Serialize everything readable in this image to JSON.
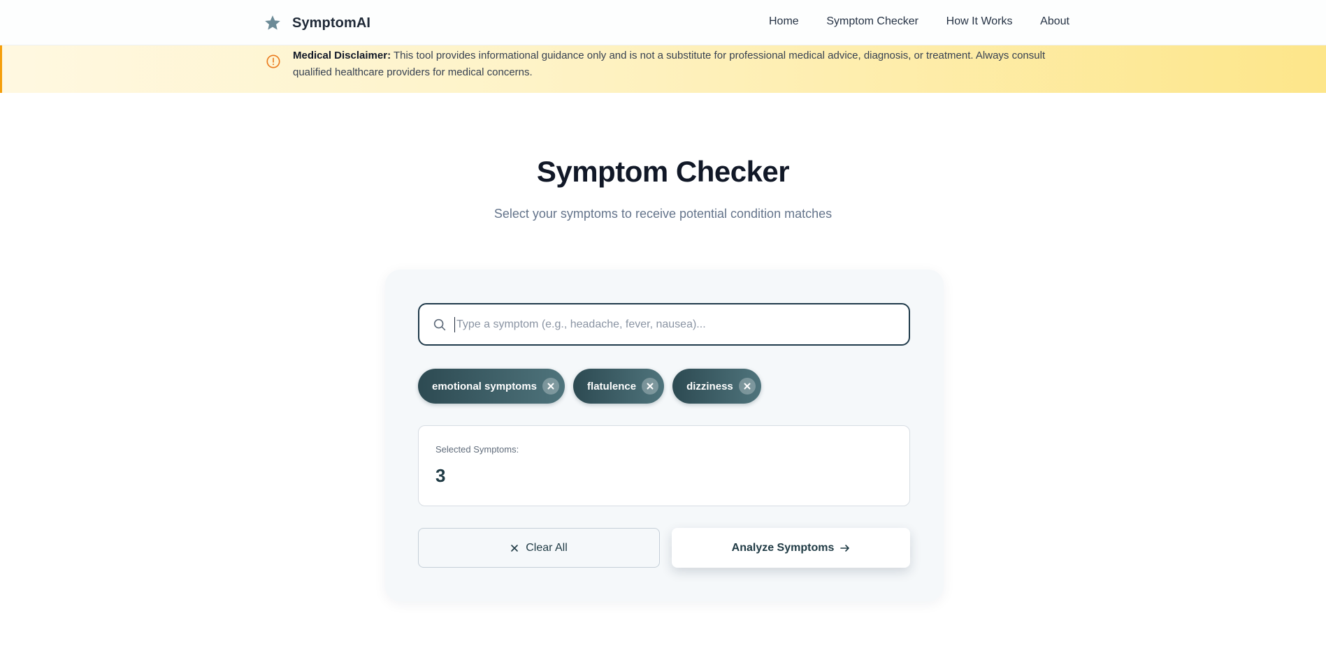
{
  "header": {
    "brand": "SymptomAI",
    "brand_icon": "star-icon",
    "nav": [
      "Home",
      "Symptom Checker",
      "How It Works",
      "About"
    ]
  },
  "disclaimer": {
    "icon": "alert-circle-icon",
    "label": "Medical Disclaimer:",
    "text": " This tool provides informational guidance only and is not a substitute for professional medical advice, diagnosis, or treatment. Always consult qualified healthcare providers for medical concerns."
  },
  "hero": {
    "title": "Symptom Checker",
    "subtitle": "Select your symptoms to receive potential condition matches"
  },
  "search": {
    "icon": "search-icon",
    "value": "",
    "placeholder": "Type a symptom (e.g., headache, fever, nausea)..."
  },
  "chips": [
    "emotional symptoms",
    "flatulence",
    "dizziness"
  ],
  "summary": {
    "label": "Selected Symptoms:",
    "count": "3"
  },
  "actions": {
    "clear_label": "Clear All",
    "analyze_label": "Analyze Symptoms"
  },
  "colors": {
    "accent": "#2d4a52",
    "disclaimer_bg": "#fde68a",
    "warning": "#f59e0b"
  }
}
